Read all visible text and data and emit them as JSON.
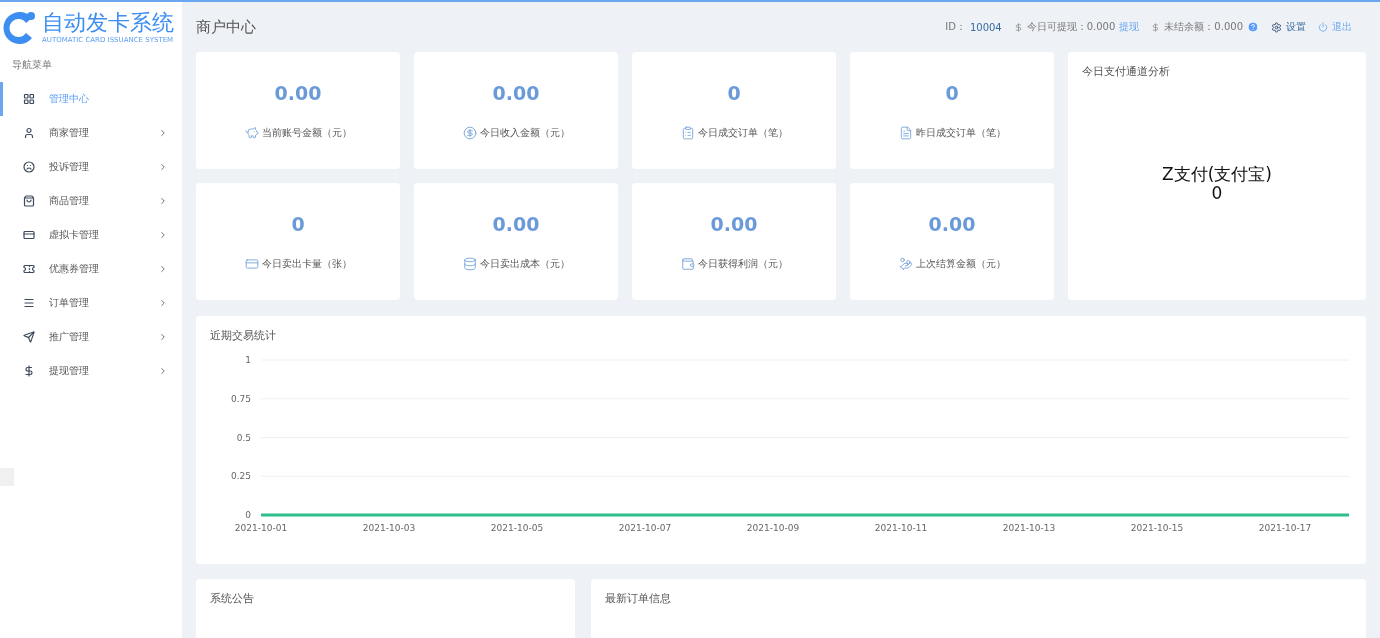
{
  "logo": {
    "title": "自动发卡系统",
    "subtitle": "AUTOMATIC CARD ISSUANCE SYSTEM"
  },
  "sidebar": {
    "heading": "导航菜单",
    "items": [
      {
        "label": "管理中心",
        "kind": "dashboard",
        "selected": true,
        "has_children": false
      },
      {
        "label": "商家管理",
        "kind": "user",
        "selected": false,
        "has_children": true
      },
      {
        "label": "投诉管理",
        "kind": "frown",
        "selected": false,
        "has_children": true
      },
      {
        "label": "商品管理",
        "kind": "bag",
        "selected": false,
        "has_children": true
      },
      {
        "label": "虚拟卡管理",
        "kind": "card",
        "selected": false,
        "has_children": true
      },
      {
        "label": "优惠券管理",
        "kind": "ticket",
        "selected": false,
        "has_children": true
      },
      {
        "label": "订单管理",
        "kind": "list",
        "selected": false,
        "has_children": true
      },
      {
        "label": "推广管理",
        "kind": "send",
        "selected": false,
        "has_children": true
      },
      {
        "label": "提现管理",
        "kind": "dollar",
        "selected": false,
        "has_children": true
      }
    ]
  },
  "header": {
    "title": "商户中心",
    "id_label": "ID：",
    "id_value": "10004",
    "withdrawable_label": "今日可提现：0.000",
    "withdraw_link": "提现",
    "unsettled_label": "未结余额：0.000",
    "settings": "设置",
    "logout": "退出"
  },
  "stats": [
    {
      "value": "0.00",
      "label": "当前账号金额（元）",
      "kind": "piggy"
    },
    {
      "value": "0.00",
      "label": "今日收入金额（元）",
      "kind": "coin"
    },
    {
      "value": "0",
      "label": "今日成交订单（笔）",
      "kind": "order"
    },
    {
      "value": "0",
      "label": "昨日成交订单（笔）",
      "kind": "list"
    },
    {
      "value": "0",
      "label": "今日卖出卡量（张）",
      "kind": "card"
    },
    {
      "value": "0.00",
      "label": "今日卖出成本（元）",
      "kind": "stack"
    },
    {
      "value": "0.00",
      "label": "今日获得利润（元）",
      "kind": "wallet"
    },
    {
      "value": "0.00",
      "label": "上次结算金额（元）",
      "kind": "hand"
    }
  ],
  "channel_panel": {
    "title": "今日支付通道分析",
    "channel": "Z支付(支付宝)",
    "count": "0"
  },
  "trade_chart": {
    "title": "近期交易统计",
    "chart_data": {
      "type": "line",
      "x": [
        "2021-10-01",
        "2021-10-02",
        "2021-10-03",
        "2021-10-04",
        "2021-10-05",
        "2021-10-06",
        "2021-10-07",
        "2021-10-08",
        "2021-10-09",
        "2021-10-10",
        "2021-10-11",
        "2021-10-12",
        "2021-10-13",
        "2021-10-14",
        "2021-10-15",
        "2021-10-16",
        "2021-10-17",
        "2021-10-18"
      ],
      "series": [
        {
          "color": "#2fbf8a",
          "values": [
            0,
            0,
            0,
            0,
            0,
            0,
            0,
            0,
            0,
            0,
            0,
            0,
            0,
            0,
            0,
            0,
            0,
            0
          ]
        }
      ],
      "grid": true,
      "xlim": [
        "2021-10-01",
        "2021-10-18"
      ],
      "ylim": [
        0,
        1
      ],
      "yticks": [
        0,
        0.25,
        0.5,
        0.75,
        1
      ],
      "xticks": [
        "2021-10-01",
        "2021-10-03",
        "2021-10-05",
        "2021-10-07",
        "2021-10-09",
        "2021-10-11",
        "2021-10-13",
        "2021-10-15",
        "2021-10-17"
      ]
    }
  },
  "notice_panel": {
    "title": "系统公告"
  },
  "orders_panel": {
    "title": "最新订单信息"
  }
}
